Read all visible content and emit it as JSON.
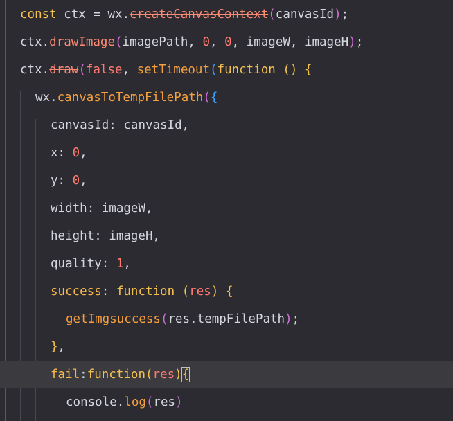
{
  "lines": [
    {
      "tokens": [
        {
          "t": "const",
          "c": "kw"
        },
        {
          "t": " ctx = wx.",
          "c": "var"
        },
        {
          "t": "createCanvasContext",
          "c": "strike"
        },
        {
          "t": "(",
          "c": "paren2"
        },
        {
          "t": "canvasId",
          "c": "var"
        },
        {
          "t": ")",
          "c": "paren2"
        },
        {
          "t": ";",
          "c": "var"
        }
      ]
    },
    {
      "tokens": [
        {
          "t": "ctx.",
          "c": "var"
        },
        {
          "t": "drawImage",
          "c": "strike"
        },
        {
          "t": "(",
          "c": "paren2"
        },
        {
          "t": "imagePath, ",
          "c": "var"
        },
        {
          "t": "0",
          "c": "num"
        },
        {
          "t": ", ",
          "c": "var"
        },
        {
          "t": "0",
          "c": "num"
        },
        {
          "t": ", imageW, imageH",
          "c": "var"
        },
        {
          "t": ")",
          "c": "paren2"
        },
        {
          "t": ";",
          "c": "var"
        }
      ]
    },
    {
      "tokens": [
        {
          "t": "ctx.",
          "c": "var"
        },
        {
          "t": "draw",
          "c": "strike"
        },
        {
          "t": "(",
          "c": "paren2"
        },
        {
          "t": "false",
          "c": "num"
        },
        {
          "t": ", ",
          "c": "var"
        },
        {
          "t": "setTimeout",
          "c": "fn"
        },
        {
          "t": "(",
          "c": "paren3"
        },
        {
          "t": "function",
          "c": "kw"
        },
        {
          "t": " ",
          "c": "var"
        },
        {
          "t": "()",
          "c": "paren1"
        },
        {
          "t": " ",
          "c": "var"
        },
        {
          "t": "{",
          "c": "paren1"
        }
      ]
    },
    {
      "tokens": [
        {
          "t": "wx.",
          "c": "var"
        },
        {
          "t": "canvasToTempFilePath",
          "c": "fn"
        },
        {
          "t": "(",
          "c": "paren2"
        },
        {
          "t": "{",
          "c": "paren3"
        }
      ]
    },
    {
      "tokens": [
        {
          "t": "canvasId",
          "c": "prop"
        },
        {
          "t": ": canvasId,",
          "c": "var"
        }
      ]
    },
    {
      "tokens": [
        {
          "t": "x",
          "c": "prop"
        },
        {
          "t": ": ",
          "c": "var"
        },
        {
          "t": "0",
          "c": "num"
        },
        {
          "t": ",",
          "c": "var"
        }
      ]
    },
    {
      "tokens": [
        {
          "t": "y",
          "c": "prop"
        },
        {
          "t": ": ",
          "c": "var"
        },
        {
          "t": "0",
          "c": "num"
        },
        {
          "t": ",",
          "c": "var"
        }
      ]
    },
    {
      "tokens": [
        {
          "t": "width",
          "c": "prop"
        },
        {
          "t": ": imageW,",
          "c": "var"
        }
      ]
    },
    {
      "tokens": [
        {
          "t": "height",
          "c": "prop"
        },
        {
          "t": ": imageH,",
          "c": "var"
        }
      ]
    },
    {
      "tokens": [
        {
          "t": "quality",
          "c": "prop"
        },
        {
          "t": ": ",
          "c": "var"
        },
        {
          "t": "1",
          "c": "num"
        },
        {
          "t": ",",
          "c": "var"
        }
      ]
    },
    {
      "tokens": [
        {
          "t": "success",
          "c": "keyprop"
        },
        {
          "t": ": ",
          "c": "var"
        },
        {
          "t": "function",
          "c": "kw"
        },
        {
          "t": " ",
          "c": "var"
        },
        {
          "t": "(",
          "c": "paren1"
        },
        {
          "t": "res",
          "c": "num"
        },
        {
          "t": ")",
          "c": "paren1"
        },
        {
          "t": " ",
          "c": "var"
        },
        {
          "t": "{",
          "c": "paren1"
        }
      ]
    },
    {
      "tokens": [
        {
          "t": "getImgsuccess",
          "c": "fn"
        },
        {
          "t": "(",
          "c": "paren2"
        },
        {
          "t": "res.tempFilePath",
          "c": "var"
        },
        {
          "t": ")",
          "c": "paren2"
        },
        {
          "t": ";",
          "c": "var"
        }
      ]
    },
    {
      "tokens": [
        {
          "t": "}",
          "c": "paren1"
        },
        {
          "t": ",",
          "c": "var"
        }
      ]
    },
    {
      "tokens": [
        {
          "t": "fail",
          "c": "keyprop"
        },
        {
          "t": ":",
          "c": "var"
        },
        {
          "t": "function",
          "c": "kw"
        },
        {
          "t": "(",
          "c": "paren1"
        },
        {
          "t": "res",
          "c": "num"
        },
        {
          "t": ")",
          "c": "paren1"
        },
        {
          "t": "{",
          "c": "paren1 hlparen"
        }
      ]
    },
    {
      "tokens": [
        {
          "t": "console.",
          "c": "var"
        },
        {
          "t": "log",
          "c": "fn"
        },
        {
          "t": "(",
          "c": "paren2"
        },
        {
          "t": "res",
          "c": "var"
        },
        {
          "t": ")",
          "c": "paren2"
        }
      ]
    }
  ]
}
